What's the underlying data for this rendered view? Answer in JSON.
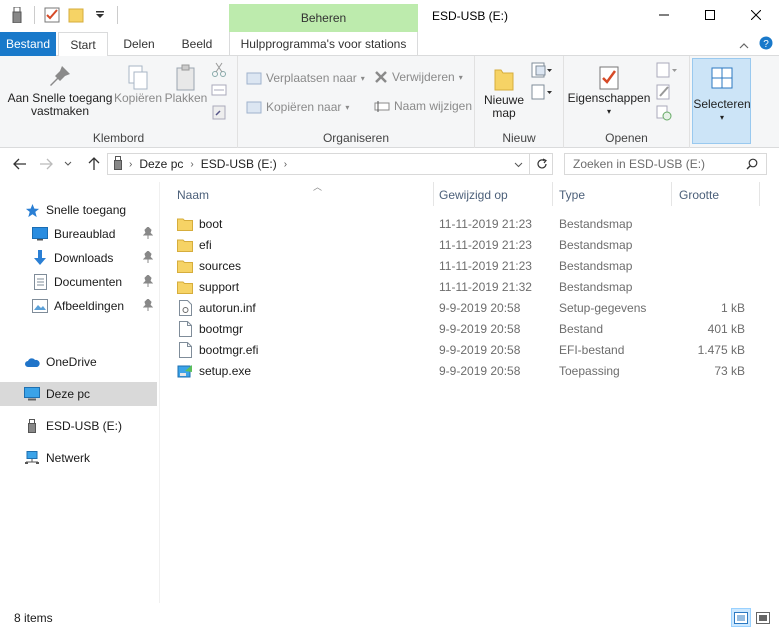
{
  "window": {
    "title": "ESD-USB (E:)",
    "context_tab_header": "Beheren"
  },
  "tabs": {
    "file": "Bestand",
    "start": "Start",
    "share": "Delen",
    "view": "Beeld",
    "drive_tools": "Hulpprogramma's voor stations"
  },
  "ribbon": {
    "clipboard": {
      "label": "Klembord",
      "pin_quick_access": "Aan Snelle toegang vastmaken",
      "copy": "Kopiëren",
      "paste": "Plakken"
    },
    "organize": {
      "label": "Organiseren",
      "move_to": "Verplaatsen naar",
      "copy_to": "Kopiëren naar",
      "delete": "Verwijderen",
      "rename": "Naam wijzigen"
    },
    "new": {
      "label": "Nieuw",
      "new_folder": "Nieuwe map"
    },
    "open": {
      "label": "Openen",
      "properties": "Eigenschappen"
    },
    "select": {
      "label": "Selecteren"
    }
  },
  "address": {
    "crumbs": [
      "Deze pc",
      "ESD-USB (E:)"
    ],
    "search_placeholder": "Zoeken in ESD-USB (E:)"
  },
  "nav": {
    "quick_access": "Snelle toegang",
    "desktop": "Bureaublad",
    "downloads": "Downloads",
    "documents": "Documenten",
    "pictures": "Afbeeldingen",
    "onedrive": "OneDrive",
    "this_pc": "Deze pc",
    "usb": "ESD-USB (E:)",
    "network": "Netwerk"
  },
  "columns": {
    "name": "Naam",
    "modified": "Gewijzigd op",
    "type": "Type",
    "size": "Grootte"
  },
  "files": [
    {
      "name": "boot",
      "date": "11-11-2019 21:23",
      "type": "Bestandsmap",
      "size": "",
      "icon": "folder-icon"
    },
    {
      "name": "efi",
      "date": "11-11-2019 21:23",
      "type": "Bestandsmap",
      "size": "",
      "icon": "folder-icon"
    },
    {
      "name": "sources",
      "date": "11-11-2019 21:23",
      "type": "Bestandsmap",
      "size": "",
      "icon": "folder-icon"
    },
    {
      "name": "support",
      "date": "11-11-2019 21:32",
      "type": "Bestandsmap",
      "size": "",
      "icon": "folder-icon"
    },
    {
      "name": "autorun.inf",
      "date": "9-9-2019 20:58",
      "type": "Setup-gegevens",
      "size": "1 kB",
      "icon": "setup-file-icon"
    },
    {
      "name": "bootmgr",
      "date": "9-9-2019 20:58",
      "type": "Bestand",
      "size": "401 kB",
      "icon": "file-icon"
    },
    {
      "name": "bootmgr.efi",
      "date": "9-9-2019 20:58",
      "type": "EFI-bestand",
      "size": "1.475 kB",
      "icon": "file-icon"
    },
    {
      "name": "setup.exe",
      "date": "9-9-2019 20:58",
      "type": "Toepassing",
      "size": "73 kB",
      "icon": "setup-exe-icon"
    }
  ],
  "status": {
    "items": "8 items"
  },
  "colors": {
    "file_tab": "#1979ca",
    "context_header": "#bdebad",
    "selected_nav": "#d9d9d9",
    "folder": "#f6d365"
  }
}
